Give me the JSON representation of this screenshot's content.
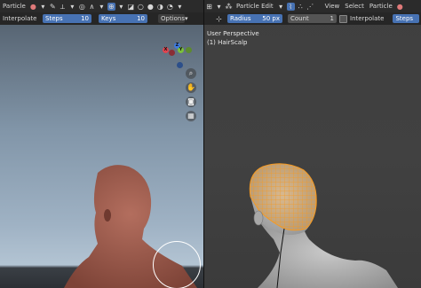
{
  "left": {
    "header": {
      "mode_label": "Particle",
      "options_label": "Options"
    },
    "tool_settings": {
      "interpolate_label": "Interpolate",
      "steps_label": "Steps",
      "steps_value": "10",
      "keys_label": "Keys",
      "keys_value": "10"
    },
    "gizmo": {
      "z": "Z",
      "y": "Y",
      "x": "X"
    }
  },
  "right": {
    "header": {
      "mode_label": "Particle Edit",
      "menus": [
        "View",
        "Select",
        "Particle"
      ]
    },
    "tool_settings": {
      "radius_label": "Radius",
      "radius_value": "50 px",
      "count_label": "Count",
      "count_value": "1",
      "interpolate_label": "Interpolate",
      "steps_label": "Steps"
    },
    "overlay": {
      "perspective": "User Perspective",
      "object": "(1) HairScalp"
    }
  },
  "colors": {
    "accent": "#4772b3",
    "hair_guide": "#f59a23",
    "axis_x": "#e0444f",
    "axis_y": "#7bc13b",
    "axis_z": "#3f7be0"
  }
}
